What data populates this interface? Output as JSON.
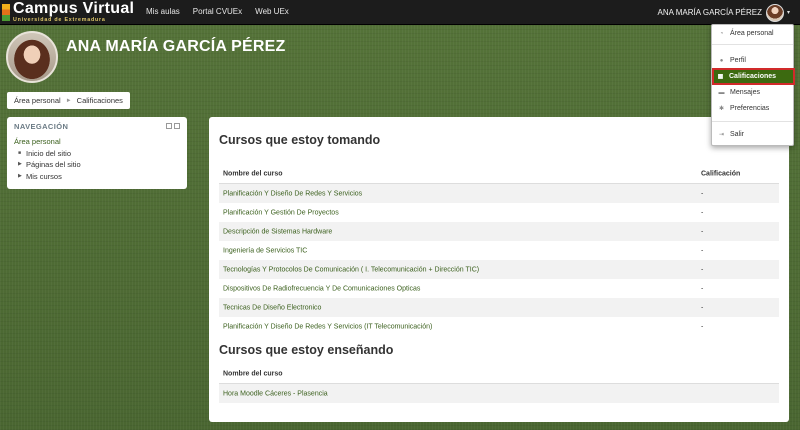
{
  "navbar": {
    "brand_title": "Campus Virtual",
    "brand_subtitle": "Universidad de Extremadura",
    "links": [
      "Mis aulas",
      "Portal CVUEx",
      "Web UEx"
    ],
    "user_name": "ANA MARÍA GARCÍA PÉREZ",
    "caret": "▾"
  },
  "header": {
    "title": "ANA MARÍA GARCÍA PÉREZ"
  },
  "breadcrumb": {
    "items": [
      "Área personal",
      "Calificaciones"
    ],
    "separator": "►"
  },
  "navigation": {
    "title": "NAVEGACIÓN",
    "root": "Área personal",
    "items": [
      {
        "label": "Inicio del sitio",
        "marker": "■"
      },
      {
        "label": "Páginas del sitio",
        "marker": "▶"
      },
      {
        "label": "Mis cursos",
        "marker": "▶"
      }
    ]
  },
  "main": {
    "taking": {
      "title": "Cursos que estoy tomando",
      "col_course": "Nombre del curso",
      "col_grade": "Calificación",
      "rows": [
        {
          "course": "Planificación Y Diseño De Redes Y Servicios",
          "grade": "-"
        },
        {
          "course": "Planificación Y Gestión De Proyectos",
          "grade": "-"
        },
        {
          "course": "Descripción de Sistemas Hardware",
          "grade": "-"
        },
        {
          "course": "Ingeniería de Servicios TIC",
          "grade": "-"
        },
        {
          "course": "Tecnologías Y Protocolos De Comunicación ( I. Telecomunicación + Dirección TIC)",
          "grade": "-"
        },
        {
          "course": "Dispositivos De Radiofrecuencia Y De Comunicaciones Opticas",
          "grade": "-"
        },
        {
          "course": "Tecnicas De Diseño Electronico",
          "grade": "-"
        },
        {
          "course": "Planificación Y Diseño De Redes Y Servicios (IT Telecomunicación)",
          "grade": "-"
        }
      ]
    },
    "teaching": {
      "title": "Cursos que estoy enseñando",
      "col_course": "Nombre del curso",
      "rows": [
        {
          "course": "Hora Moodle Cáceres - Plasencia"
        }
      ]
    }
  },
  "user_menu": {
    "items": [
      {
        "label": "Área personal",
        "icon": "dashboard-icon",
        "glyph": "◔"
      },
      {
        "label": "Perfil",
        "icon": "user-icon",
        "glyph": "●"
      },
      {
        "label": "Calificaciones",
        "icon": "grades-icon",
        "glyph": "▦"
      },
      {
        "label": "Mensajes",
        "icon": "messages-icon",
        "glyph": "▬"
      },
      {
        "label": "Preferencias",
        "icon": "gear-icon",
        "glyph": "✱"
      },
      {
        "label": "Salir",
        "icon": "logout-icon",
        "glyph": "⇥"
      }
    ],
    "active_label": "Calificaciones"
  },
  "colors": {
    "background_green": "#4e6a34",
    "link_green": "#3a5f1c",
    "active_item": "#3c6a10",
    "highlight_border": "#d12a2a",
    "navbar": "#1c1c1c"
  }
}
